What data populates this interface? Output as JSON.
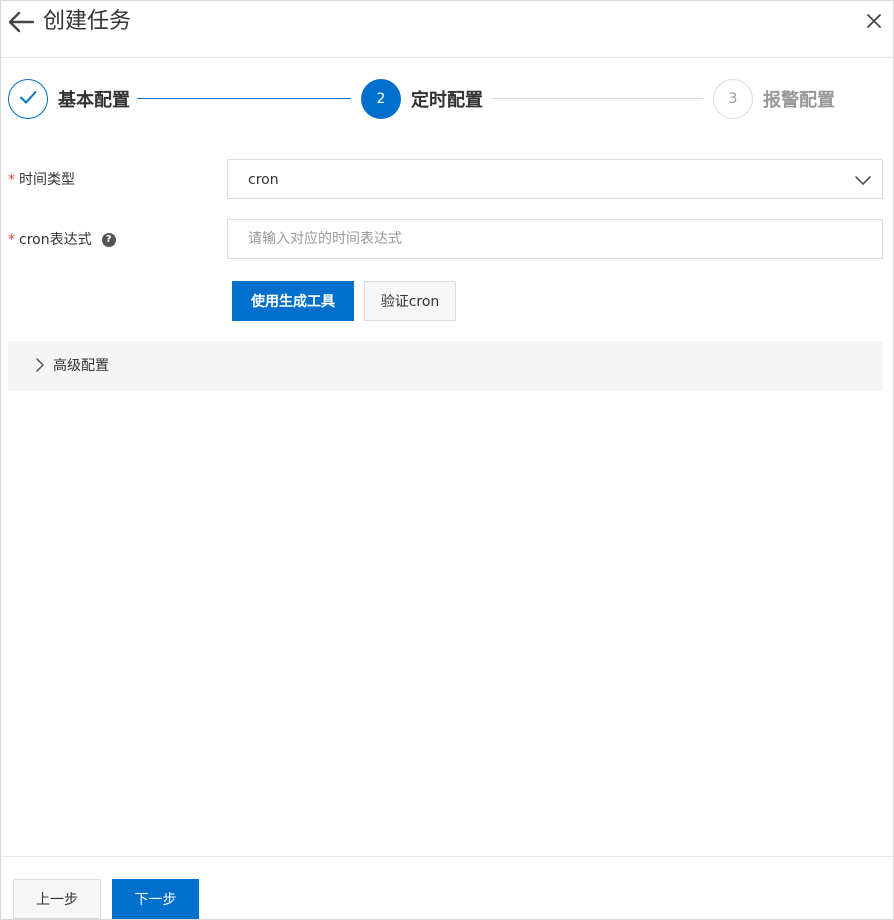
{
  "header": {
    "title": "创建任务",
    "back_icon": "arrow-left-icon",
    "close_icon": "close-icon"
  },
  "steps": [
    {
      "number": "1",
      "label": "基本配置",
      "state": "completed",
      "icon": "check-icon"
    },
    {
      "number": "2",
      "label": "定时配置",
      "state": "active"
    },
    {
      "number": "3",
      "label": "报警配置",
      "state": "pending"
    }
  ],
  "form": {
    "time_type": {
      "required_mark": "*",
      "label": "时间类型",
      "value": "cron",
      "icon": "chevron-down-icon"
    },
    "cron_expression": {
      "required_mark": "*",
      "label": "cron表达式",
      "help_symbol": "?",
      "value": "",
      "placeholder": "请输入对应的时间表达式"
    },
    "generator_button": "使用生成工具",
    "validate_button": "验证cron"
  },
  "advanced": {
    "label": "高级配置",
    "icon": "chevron-right-icon",
    "expanded": false
  },
  "footer": {
    "prev_button": "上一步",
    "next_button": "下一步"
  },
  "colors": {
    "primary": "#0070cc",
    "required": "#e84738",
    "muted": "#999999"
  }
}
